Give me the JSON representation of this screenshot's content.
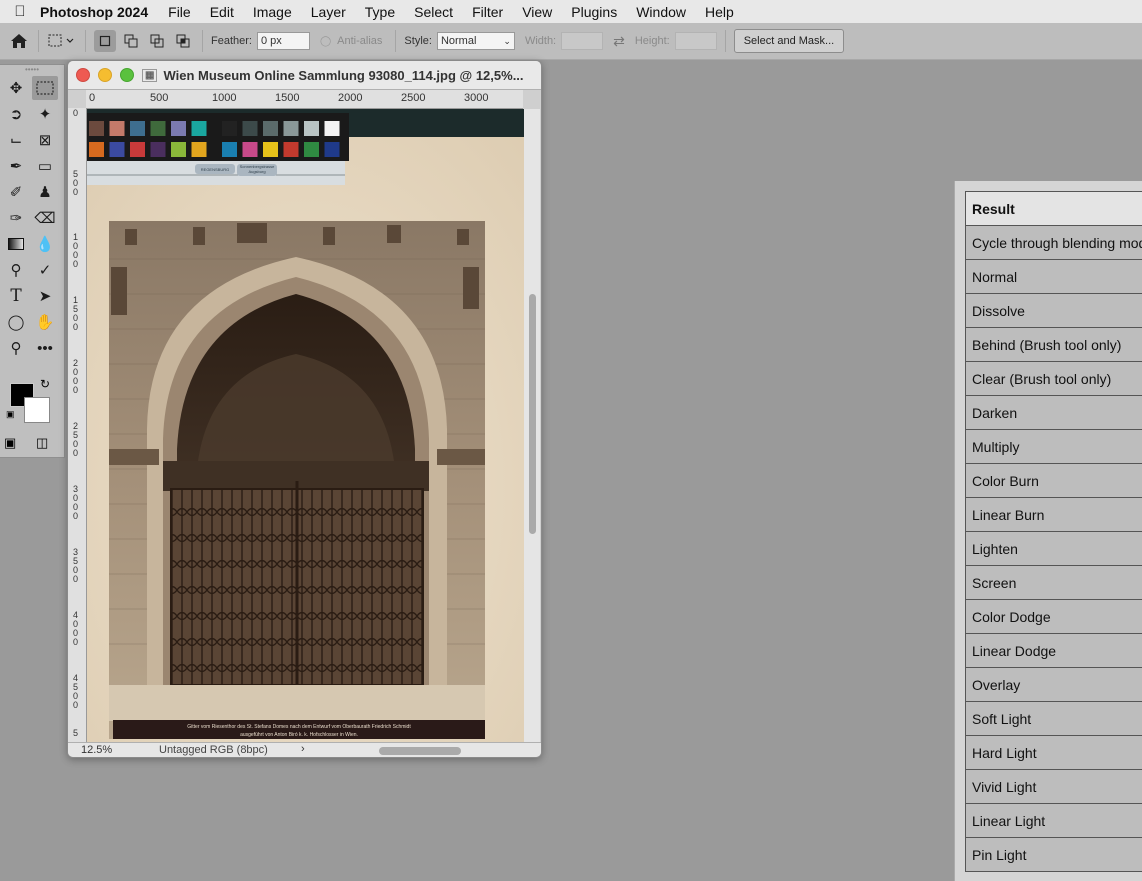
{
  "menubar": {
    "app_name": "Photoshop 2024",
    "items": [
      "File",
      "Edit",
      "Image",
      "Layer",
      "Type",
      "Select",
      "Filter",
      "View",
      "Plugins",
      "Window",
      "Help"
    ]
  },
  "options_bar": {
    "feather_label": "Feather:",
    "feather_value": "0 px",
    "antialias_label": "Anti-alias",
    "style_label": "Style:",
    "style_value": "Normal",
    "width_label": "Width:",
    "height_label": "Height:",
    "select_mask_label": "Select and Mask..."
  },
  "document": {
    "title": "Wien Museum Online Sammlung 93080_114.jpg @ 12,5%...",
    "zoom": "12.5%",
    "color_profile": "Untagged RGB (8bpc)",
    "ruler_h_labels": [
      "0",
      "500",
      "1000",
      "1500",
      "2000",
      "2500",
      "3000"
    ],
    "ruler_v_labels": [
      "0",
      "5 0 0",
      "1 0 0 0",
      "1 5 0 0",
      "2 0 0 0",
      "2 5 0 0",
      "3 0 0 0",
      "3 5 0 0",
      "4 0 0 0",
      "4 5 0 0",
      "5"
    ],
    "ruler_strip_tags": [
      "REGENSBURG",
      "Sonnenbergstrasse",
      "Augsburg"
    ],
    "photo_caption_line1": "Gitter vom Riesenthor des St. Stefans Domes nach dem Entwurf vom Oberbaurath Friedrich Schmidt",
    "photo_caption_line2": "ausgeführt von Anton Biró k. k. Hofschlosser in Wien.",
    "swatches_row1": [
      "#6b4a3e",
      "#c47a6a",
      "#3e6e8f",
      "#3f6a3c",
      "#7b7ab0",
      "#1aa7a0",
      "#222222",
      "#3c4a4a",
      "#5b6b6b",
      "#8a9898",
      "#b9c4c4",
      "#f2f2f2"
    ],
    "swatches_row2": [
      "#d66a1f",
      "#3b4aa0",
      "#c83a3a",
      "#4a2e5e",
      "#8ab73a",
      "#e2a51e",
      "#1a7fb0",
      "#c84a8a",
      "#e6c21a",
      "#c23a2e",
      "#2f8a42",
      "#1f3a8a"
    ]
  },
  "result_table": {
    "header": "Result",
    "rows": [
      "Cycle through blending modes",
      "Normal",
      "Dissolve",
      "Behind (Brush tool only)",
      "Clear (Brush tool only)",
      "Darken",
      "Multiply",
      "Color Burn",
      "Linear Burn",
      "Lighten",
      "Screen",
      "Color Dodge",
      "Linear Dodge",
      "Overlay",
      "Soft Light",
      "Hard Light",
      "Vivid Light",
      "Linear Light",
      "Pin Light"
    ]
  }
}
